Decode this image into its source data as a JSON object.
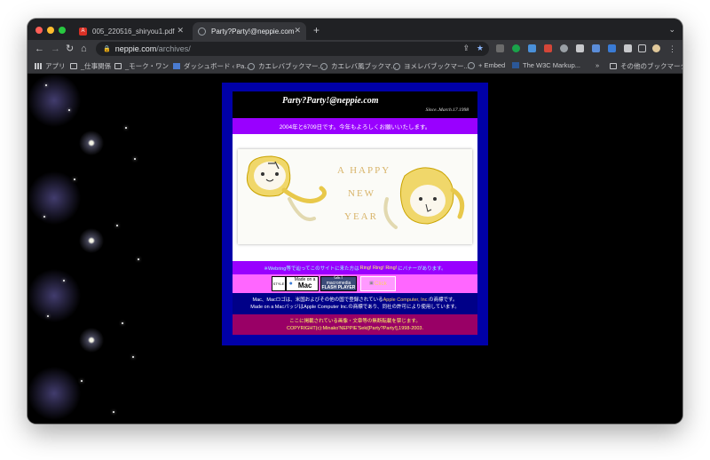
{
  "browser": {
    "tabs": [
      {
        "label": "005_220516_shiryou1.pdf",
        "active": false
      },
      {
        "label": "Party?Party!@neppie.com",
        "active": true
      }
    ],
    "address": {
      "domain": "neppie.com",
      "path": "/archives/"
    },
    "bookmarks": [
      {
        "label": "アプリ",
        "icon": "apps-grid-icon"
      },
      {
        "label": "_仕事関係",
        "icon": "folder-icon"
      },
      {
        "label": "_モーク・ワン",
        "icon": "folder-icon"
      },
      {
        "label": "ダッシュボード ‹ Pa...",
        "icon": "wordpress-icon"
      },
      {
        "label": "カエレバブックマー...",
        "icon": "globe-icon"
      },
      {
        "label": "カエレバ風ブックマ...",
        "icon": "globe-icon"
      },
      {
        "label": "ヨメレバブックマー...",
        "icon": "globe-icon"
      },
      {
        "label": "+ Embed",
        "icon": "globe-icon"
      },
      {
        "label": "The W3C Markup...",
        "icon": "w3c-icon"
      },
      {
        "label": "»",
        "icon": ""
      },
      {
        "label": "その他のブックマーク",
        "icon": "folder-icon"
      }
    ]
  },
  "page": {
    "site_title": "Party?Party!@neppie.com",
    "since": "Since..March.17.1998",
    "greeting": "2004年と6709日です。今年もよろしくお願いいたします。",
    "banner": {
      "line1": "A HAPPY",
      "line2": "NEW",
      "line3": "YEAR"
    },
    "webring": {
      "prefix": "※Webring等で辿ってこのサイトに来た方は",
      "link": "Ring! Ring! Ring!",
      "suffix": "にバナーがあります。"
    },
    "badges": {
      "style": "STYLE",
      "mac_top": "Made on a",
      "mac_main": "Mac",
      "flash_top": "GET macromedia",
      "flash_main": "FLASH PLAYER",
      "click": "Click"
    },
    "legal": {
      "line1_pre": "Mac、Macロゴは、米国およびその他の国で登録されている",
      "line1_link": "Apple Computer, Inc.",
      "line1_post": "の商標です。",
      "line2": "Made on a MacバッジはApple Computer Inc.の商標であり、同社の許可により使用しています。"
    },
    "copyright": {
      "line1": "ここに掲載されている画像・文章等の無断転載を禁じます。",
      "line2": "COPYRIGHT(c):Minako'NEPPIE'Seki[Party?Party!],1998-2003."
    }
  },
  "colors": {
    "panel_border": "#0000a8",
    "greeting_bg": "#9900ff",
    "badge_bar_bg": "#ff66ff",
    "legal_bg": "#000088",
    "copyright_bg": "#990066"
  }
}
